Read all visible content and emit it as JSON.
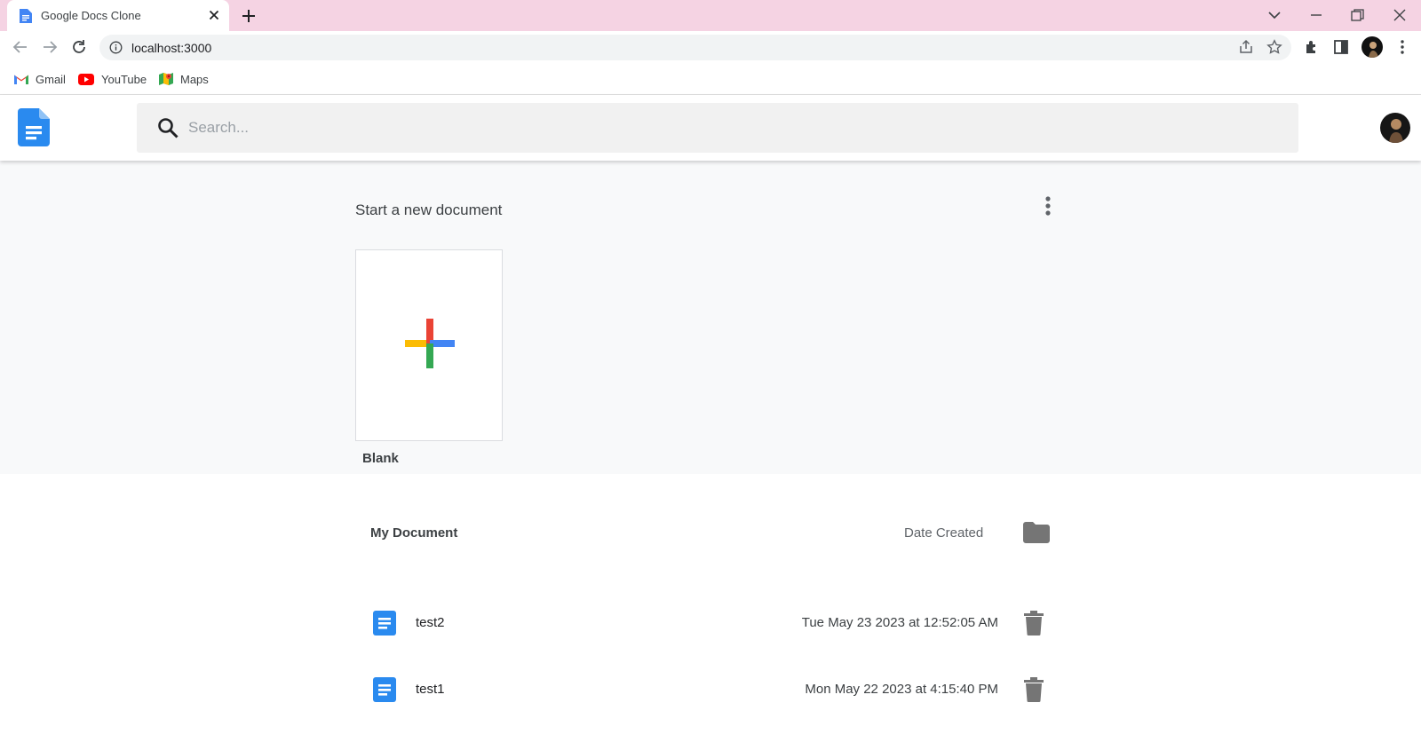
{
  "browser": {
    "tab_title": "Google Docs Clone",
    "url": "localhost:3000",
    "bookmarks": [
      {
        "label": "Gmail",
        "icon": "gmail-icon"
      },
      {
        "label": "YouTube",
        "icon": "youtube-icon"
      },
      {
        "label": "Maps",
        "icon": "maps-icon"
      }
    ],
    "colors": {
      "tabstrip": "#f5d3e3"
    }
  },
  "app": {
    "search_placeholder": "Search...",
    "accent": "#2a8aef"
  },
  "templates": {
    "title": "Start a new document",
    "blank_label": "Blank"
  },
  "documents": {
    "header_title": "My Document",
    "header_date": "Date Created",
    "items": [
      {
        "name": "test2",
        "date": "Tue May 23 2023 at 12:52:05 AM"
      },
      {
        "name": "test1",
        "date": "Mon May 22 2023 at 4:15:40 PM"
      }
    ]
  }
}
